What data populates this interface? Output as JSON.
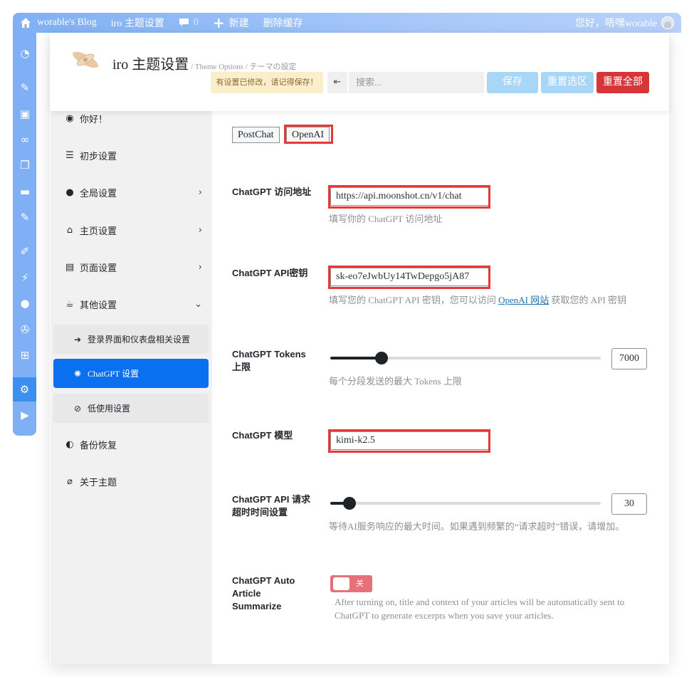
{
  "adminbar": {
    "site_name": "worable's Blog",
    "theme_settings": "iro 主题设置",
    "comments_count": "0",
    "new_label": "新建",
    "clear_cache": "删除缓存",
    "greeting": "您好，唔嘿worable"
  },
  "header": {
    "title": "iro 主题设置",
    "subtitle": " / Theme Options / テーマの設定",
    "notice": "有设置已修改，请记得保存！",
    "search_placeholder": "搜索...",
    "save": "保存",
    "reset_section": "重置选区",
    "reset_all": "重置全部"
  },
  "nav": {
    "items": [
      {
        "label": "你好！",
        "icon": "hello-icon"
      },
      {
        "label": "初步设置",
        "icon": "sliders-icon"
      },
      {
        "label": "全局设置",
        "icon": "globe-icon"
      },
      {
        "label": "主页设置",
        "icon": "home-icon"
      },
      {
        "label": "页面设置",
        "icon": "page-icon"
      },
      {
        "label": "其他设置",
        "icon": "coffee-icon"
      }
    ],
    "sub_items": [
      {
        "label": "登录界面和仪表盘相关设置",
        "icon": "sign-in-icon"
      },
      {
        "label": "ChatGPT 设置",
        "icon": "openai-icon"
      },
      {
        "label": "低使用设置",
        "icon": "eye-slash-icon"
      }
    ],
    "bottom_items": [
      {
        "label": "备份恢复",
        "icon": "shield-icon"
      },
      {
        "label": "关于主题",
        "icon": "paperclip-icon"
      }
    ]
  },
  "content": {
    "tabs": [
      "PostChat",
      "OpenAI"
    ],
    "api_url": {
      "label": "ChatGPT 访问地址",
      "value": "https://api.moonshot.cn/v1/chat",
      "desc": "填写你的 ChatGPT 访问地址"
    },
    "api_key": {
      "label": "ChatGPT API密钥",
      "value": "sk-eo7eJwbUy14TwDepgo5jA87",
      "desc_before": "填写您的 ChatGPT API 密钥，您可以访问 ",
      "desc_link": "OpenAI 网站",
      "desc_after": " 获取您的 API 密钥"
    },
    "tokens": {
      "label_line1": "ChatGPT Tokens",
      "label_line2": "上限",
      "value": "7000",
      "slider_fraction": 0.19,
      "desc": "每个分段发送的最大 Tokens 上限"
    },
    "model": {
      "label": "ChatGPT 模型",
      "value": "kimi-k2.5"
    },
    "timeout": {
      "label_line1": "ChatGPT API 请求",
      "label_line2": "超时时间设置",
      "value": "30",
      "slider_fraction": 0.07,
      "desc": "等待AI服务响应的最大时间。如果遇到频繁的“请求超时”错误，请增加。"
    },
    "auto_summarize": {
      "label_line1": "ChatGPT Auto",
      "label_line2": "Article",
      "label_line3": "Summarize",
      "toggle_label": "关",
      "desc": "After turning on, title and context of your articles will be automatically sent to ChatGPT to generate excerpts when you save your articles."
    }
  },
  "colors": {
    "accent": "#0b70f0",
    "danger": "#d63638",
    "highlight_box": "#e53935",
    "adminbar": "#7fb0f5"
  }
}
